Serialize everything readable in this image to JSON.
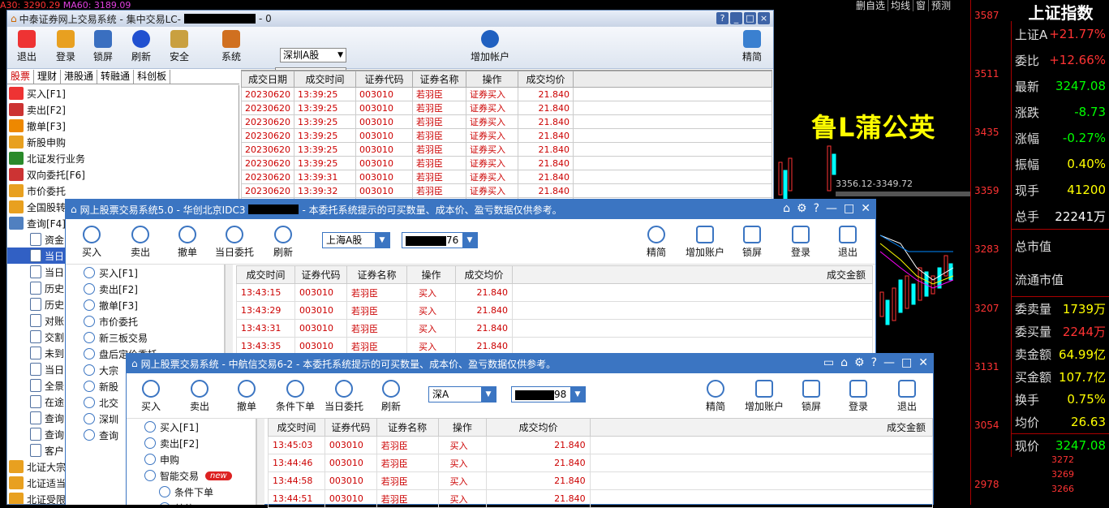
{
  "background": {
    "top_left_text": "A30: 3290.29",
    "ma60": "MA60: 3189.09",
    "top_buttons": [
      "删自选",
      "均线",
      "窗",
      "预测"
    ],
    "price_axis": [
      "3587",
      "3511",
      "3435",
      "3359",
      "3283",
      "3207",
      "3131",
      "3054",
      "2978"
    ],
    "index_title": "上证指数",
    "overlay_name": "鲁L蒲公英",
    "hilo_label": "3356.12-3349.72",
    "quote_rows": [
      {
        "label": "上证A",
        "value": "+21.77%",
        "color": "red"
      },
      {
        "label": "委比",
        "value": "+12.66%",
        "color": "red"
      },
      {
        "label": "最新",
        "value": "3247.08",
        "color": "green"
      },
      {
        "label": "涨跌",
        "value": "-8.73",
        "color": "green"
      },
      {
        "label": "涨幅",
        "value": "-0.27%",
        "color": "green"
      },
      {
        "label": "振幅",
        "value": "0.40%",
        "color": "yel"
      },
      {
        "label": "现手",
        "value": "41200",
        "color": "yel"
      },
      {
        "label": "总手",
        "value": "22241万",
        "color": "wht"
      }
    ],
    "cap_rows": [
      "总市值",
      "流通市值"
    ],
    "vol_rows": [
      {
        "label": "委卖量",
        "value": "1739万",
        "color": "yel"
      },
      {
        "label": "委买量",
        "value": "2244万",
        "color": "red"
      },
      {
        "label": "卖金额",
        "value": "64.99亿",
        "color": "yel"
      },
      {
        "label": "买金额",
        "value": "107.7亿",
        "color": "yel"
      },
      {
        "label": "换手",
        "value": "0.75%",
        "color": "yel"
      },
      {
        "label": "均价",
        "value": "26.63",
        "color": "yel"
      },
      {
        "label": "现价",
        "value": "3247.08",
        "color": "green"
      }
    ],
    "mini_prices": [
      "3272",
      "3269",
      "3266"
    ]
  },
  "win1": {
    "title": "中泰证券网上交易系统 - 集中交易LC-",
    "title_suffix": "- 0",
    "toolbar": [
      "退出",
      "登录",
      "锁屏",
      "刷新",
      "安全",
      "系统"
    ],
    "market_select": "深圳A股",
    "account_suffix": "09",
    "add_account": "增加帐户",
    "simple": "精简",
    "tabs": [
      "股票",
      "理财",
      "港股通",
      "转融通",
      "科创板"
    ],
    "side_items": [
      "买入[F1]",
      "卖出[F2]",
      "撤单[F3]",
      "新股申购",
      "北证发行业务",
      "双向委托[F6]",
      "市价委托",
      "全国股转",
      "查询[F4]",
      "资金",
      "当日",
      "当日",
      "历史",
      "历史",
      "对账",
      "交割",
      "未到",
      "当日",
      "全景",
      "在途",
      "查询",
      "查询",
      "客户",
      "北证大宗",
      "北证适当",
      "北证受限"
    ],
    "cols": [
      "成交日期",
      "成交时间",
      "证券代码",
      "证券名称",
      "操作",
      "成交均价"
    ],
    "rows": [
      [
        "20230620",
        "13:39:25",
        "003010",
        "若羽臣",
        "证券买入",
        "21.840"
      ],
      [
        "20230620",
        "13:39:25",
        "003010",
        "若羽臣",
        "证券买入",
        "21.840"
      ],
      [
        "20230620",
        "13:39:25",
        "003010",
        "若羽臣",
        "证券买入",
        "21.840"
      ],
      [
        "20230620",
        "13:39:25",
        "003010",
        "若羽臣",
        "证券买入",
        "21.840"
      ],
      [
        "20230620",
        "13:39:25",
        "003010",
        "若羽臣",
        "证券买入",
        "21.840"
      ],
      [
        "20230620",
        "13:39:25",
        "003010",
        "若羽臣",
        "证券买入",
        "21.840"
      ],
      [
        "20230620",
        "13:39:31",
        "003010",
        "若羽臣",
        "证券买入",
        "21.840"
      ],
      [
        "20230620",
        "13:39:32",
        "003010",
        "若羽臣",
        "证券买入",
        "21.840"
      ],
      [
        "20230620",
        "13:42:20",
        "003010",
        "若羽臣",
        "证券买入",
        "21.840"
      ]
    ]
  },
  "win2": {
    "title_a": "网上股票交易系统5.0 - 华创北京IDC3",
    "title_b": "- 本委托系统提示的可买数量、成本价、盈亏数据仅供参考。",
    "toolbar_left": [
      "买入",
      "卖出",
      "撤单",
      "当日委托",
      "刷新"
    ],
    "toolbar_right": [
      "精简",
      "增加账户",
      "锁屏",
      "登录",
      "退出"
    ],
    "market_select": "上海A股",
    "account_suffix": "76",
    "side_items": [
      "买入[F1]",
      "卖出[F2]",
      "撤单[F3]",
      "市价委托",
      "新三板交易",
      "盘后定价委托",
      "大宗",
      "新股",
      "北交",
      "深圳",
      "查询"
    ],
    "cols": [
      "成交时间",
      "证券代码",
      "证券名称",
      "操作",
      "成交均价",
      "成交金额"
    ],
    "rows": [
      [
        "13:43:15",
        "003010",
        "若羽臣",
        "买入",
        "21.840"
      ],
      [
        "13:43:29",
        "003010",
        "若羽臣",
        "买入",
        "21.840"
      ],
      [
        "13:43:31",
        "003010",
        "若羽臣",
        "买入",
        "21.840"
      ],
      [
        "13:43:35",
        "003010",
        "若羽臣",
        "买入",
        "21.840"
      ]
    ]
  },
  "win3": {
    "title": "网上股票交易系统 - 中航信交易6-2 - 本委托系统提示的可买数量、成本价、盈亏数据仅供参考。",
    "toolbar_left": [
      "买入",
      "卖出",
      "撤单",
      "条件下单",
      "当日委托",
      "刷新"
    ],
    "toolbar_right": [
      "精简",
      "增加账户",
      "锁屏",
      "登录",
      "退出"
    ],
    "market_select": "深A",
    "account_suffix": "98",
    "side_items": [
      "买入[F1]",
      "卖出[F2]",
      "申购",
      "智能交易",
      "条件下单",
      "其他"
    ],
    "new_badge": "new",
    "cols": [
      "成交时间",
      "证券代码",
      "证券名称",
      "操作",
      "成交均价",
      "成交金额"
    ],
    "rows": [
      [
        "13:45:03",
        "003010",
        "若羽臣",
        "买入",
        "21.840"
      ],
      [
        "13:44:46",
        "003010",
        "若羽臣",
        "买入",
        "21.840"
      ],
      [
        "13:44:58",
        "003010",
        "若羽臣",
        "买入",
        "21.840"
      ],
      [
        "13:44:51",
        "003010",
        "若羽臣",
        "买入",
        "21.840"
      ]
    ]
  }
}
